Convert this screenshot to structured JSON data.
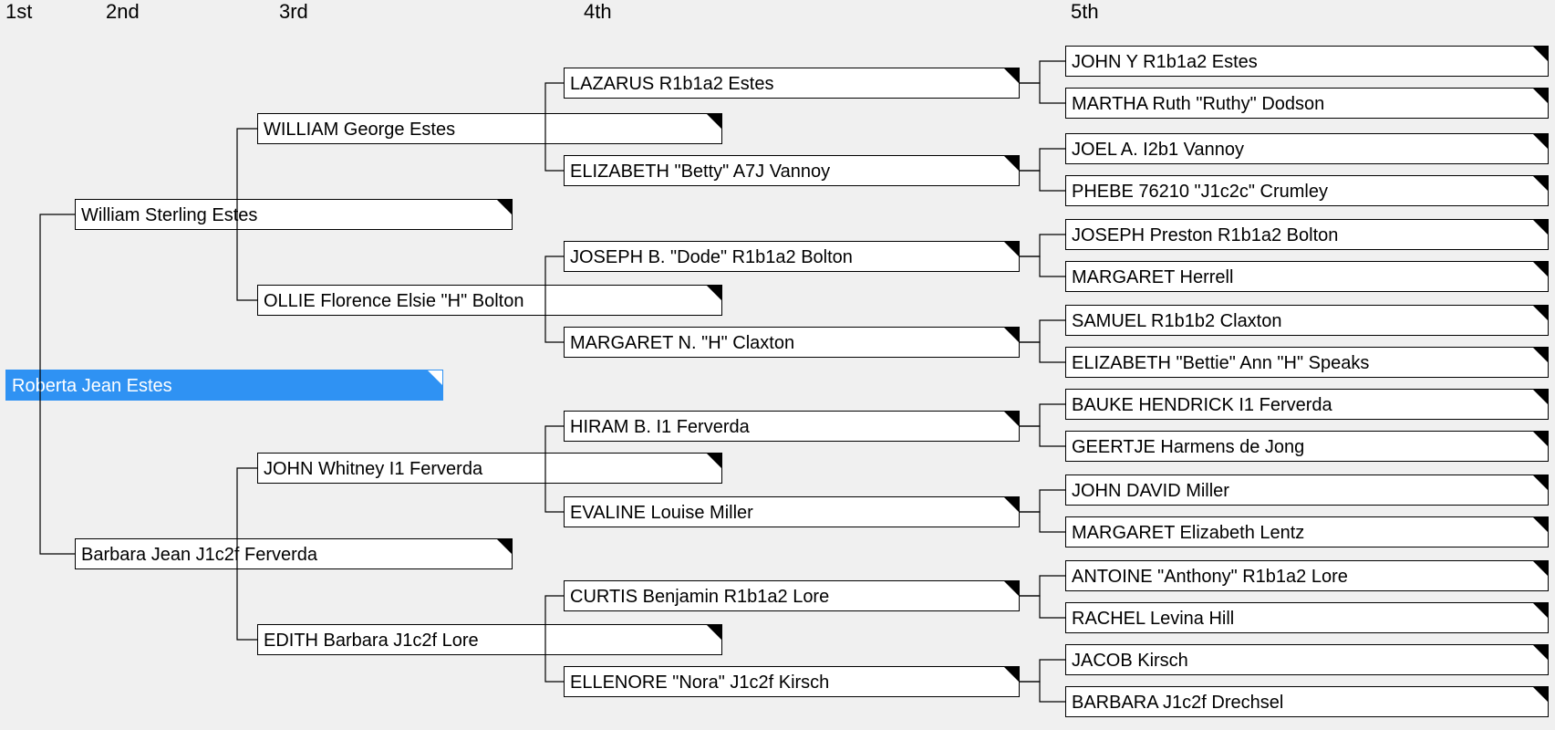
{
  "headers": {
    "g1": "1st",
    "g2": "2nd",
    "g3": "3rd",
    "g4": "4th",
    "g5": "5th"
  },
  "tree": {
    "root": {
      "name": "Roberta Jean Estes",
      "selected": true
    },
    "g2": [
      {
        "name": "William Sterling Estes"
      },
      {
        "name": "Barbara Jean J1c2f Ferverda"
      }
    ],
    "g3": [
      {
        "name": "WILLIAM George Estes"
      },
      {
        "name": "OLLIE Florence Elsie \"H\" Bolton"
      },
      {
        "name": "JOHN Whitney I1 Ferverda"
      },
      {
        "name": "EDITH Barbara J1c2f Lore"
      }
    ],
    "g4": [
      {
        "name": "LAZARUS R1b1a2 Estes"
      },
      {
        "name": "ELIZABETH \"Betty\" A7J Vannoy"
      },
      {
        "name": "JOSEPH B. \"Dode\" R1b1a2 Bolton"
      },
      {
        "name": "MARGARET N. \"H\" Claxton"
      },
      {
        "name": "HIRAM B. I1 Ferverda"
      },
      {
        "name": "EVALINE Louise Miller"
      },
      {
        "name": "CURTIS Benjamin R1b1a2 Lore"
      },
      {
        "name": "ELLENORE \"Nora\" J1c2f Kirsch"
      }
    ],
    "g5": [
      {
        "name": "JOHN Y R1b1a2 Estes"
      },
      {
        "name": "MARTHA Ruth \"Ruthy\" Dodson"
      },
      {
        "name": "JOEL A. I2b1 Vannoy"
      },
      {
        "name": "PHEBE 76210 \"J1c2c\" Crumley"
      },
      {
        "name": "JOSEPH Preston R1b1a2 Bolton"
      },
      {
        "name": "MARGARET Herrell"
      },
      {
        "name": "SAMUEL R1b1b2 Claxton"
      },
      {
        "name": "ELIZABETH \"Bettie\" Ann \"H\" Speaks"
      },
      {
        "name": "BAUKE HENDRICK I1 Ferverda"
      },
      {
        "name": "GEERTJE Harmens de Jong"
      },
      {
        "name": "JOHN DAVID Miller"
      },
      {
        "name": "MARGARET Elizabeth Lentz"
      },
      {
        "name": "ANTOINE \"Anthony\" R1b1a2 Lore"
      },
      {
        "name": "RACHEL Levina Hill"
      },
      {
        "name": "JACOB Kirsch"
      },
      {
        "name": "BARBARA J1c2f Drechsel"
      }
    ]
  },
  "chart_data": {
    "type": "tree",
    "title": "Pedigree chart",
    "generations": [
      "1st",
      "2nd",
      "3rd",
      "4th",
      "5th"
    ],
    "root": "Roberta Jean Estes",
    "parents": {
      "Roberta Jean Estes": [
        "William Sterling Estes",
        "Barbara Jean J1c2f Ferverda"
      ],
      "William Sterling Estes": [
        "WILLIAM George Estes",
        "OLLIE Florence Elsie \"H\" Bolton"
      ],
      "Barbara Jean J1c2f Ferverda": [
        "JOHN Whitney I1 Ferverda",
        "EDITH Barbara J1c2f Lore"
      ],
      "WILLIAM George Estes": [
        "LAZARUS R1b1a2 Estes",
        "ELIZABETH \"Betty\" A7J Vannoy"
      ],
      "OLLIE Florence Elsie \"H\" Bolton": [
        "JOSEPH B. \"Dode\" R1b1a2 Bolton",
        "MARGARET N. \"H\" Claxton"
      ],
      "JOHN Whitney I1 Ferverda": [
        "HIRAM B. I1 Ferverda",
        "EVALINE Louise Miller"
      ],
      "EDITH Barbara J1c2f Lore": [
        "CURTIS Benjamin R1b1a2 Lore",
        "ELLENORE \"Nora\" J1c2f Kirsch"
      ],
      "LAZARUS R1b1a2 Estes": [
        "JOHN Y R1b1a2 Estes",
        "MARTHA Ruth \"Ruthy\" Dodson"
      ],
      "ELIZABETH \"Betty\" A7J Vannoy": [
        "JOEL A. I2b1 Vannoy",
        "PHEBE 76210 \"J1c2c\" Crumley"
      ],
      "JOSEPH B. \"Dode\" R1b1a2 Bolton": [
        "JOSEPH Preston R1b1a2 Bolton",
        "MARGARET Herrell"
      ],
      "MARGARET N. \"H\" Claxton": [
        "SAMUEL R1b1b2 Claxton",
        "ELIZABETH \"Bettie\" Ann \"H\" Speaks"
      ],
      "HIRAM B. I1 Ferverda": [
        "BAUKE HENDRICK I1 Ferverda",
        "GEERTJE Harmens de Jong"
      ],
      "EVALINE Louise Miller": [
        "JOHN DAVID Miller",
        "MARGARET Elizabeth Lentz"
      ],
      "CURTIS Benjamin R1b1a2 Lore": [
        "ANTOINE \"Anthony\" R1b1a2 Lore",
        "RACHEL Levina Hill"
      ],
      "ELLENORE \"Nora\" J1c2f Kirsch": [
        "JACOB Kirsch",
        "BARBARA J1c2f Drechsel"
      ]
    }
  }
}
